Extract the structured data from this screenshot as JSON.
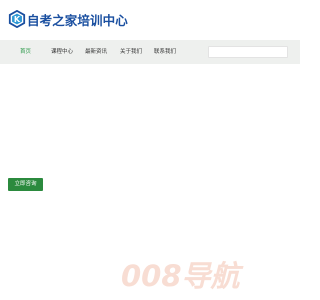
{
  "brand": {
    "logo_letter": "K",
    "name": "自考之家培训中心",
    "colors": {
      "primary": "#1a4fa0",
      "accent": "#2f9ad6"
    }
  },
  "nav": {
    "items": [
      {
        "label": "首页",
        "active": true
      },
      {
        "label": "课程中心",
        "active": false
      },
      {
        "label": "最新资讯",
        "active": false
      },
      {
        "label": "关于我们",
        "active": false
      },
      {
        "label": "联系我们",
        "active": false
      }
    ],
    "search": {
      "value": "",
      "placeholder": ""
    },
    "active_color": "#2f9a4c",
    "background": "#eef0ee"
  },
  "hero": {
    "cta_label": "立即咨询",
    "cta_color": "#2b8a3e"
  },
  "watermark": {
    "text": "008导航",
    "color": "#f8ddd3"
  }
}
